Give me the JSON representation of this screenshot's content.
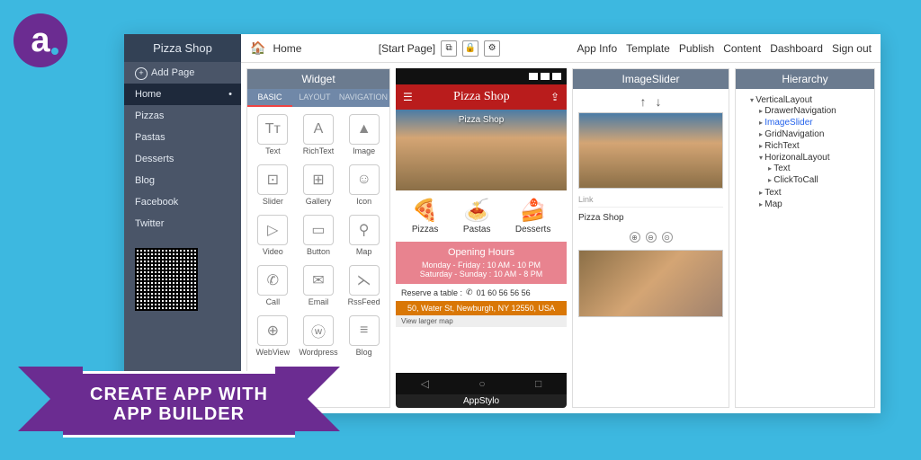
{
  "logo_letter": "a",
  "sidebar": {
    "title": "Pizza Shop",
    "add_page": "Add Page",
    "items": [
      "Home",
      "Pizzas",
      "Pastas",
      "Desserts",
      "Blog",
      "Facebook",
      "Twitter"
    ]
  },
  "toolbar": {
    "home": "Home",
    "start_page": "[Start Page]",
    "links": [
      "App Info",
      "Template",
      "Publish",
      "Content",
      "Dashboard",
      "Sign out"
    ]
  },
  "widget": {
    "title": "Widget",
    "tabs": [
      "BASIC",
      "LAYOUT",
      "NAVIGATION"
    ],
    "items": [
      {
        "label": "Text",
        "glyph": "Tт"
      },
      {
        "label": "RichText",
        "glyph": "A"
      },
      {
        "label": "Image",
        "glyph": "▲"
      },
      {
        "label": "Slider",
        "glyph": "⊡"
      },
      {
        "label": "Gallery",
        "glyph": "⊞"
      },
      {
        "label": "Icon",
        "glyph": "☺"
      },
      {
        "label": "Video",
        "glyph": "▷"
      },
      {
        "label": "Button",
        "glyph": "▭"
      },
      {
        "label": "Map",
        "glyph": "⚲"
      },
      {
        "label": "Call",
        "glyph": "✆"
      },
      {
        "label": "Email",
        "glyph": "✉"
      },
      {
        "label": "RssFeed",
        "glyph": "⋋"
      },
      {
        "label": "WebView",
        "glyph": "⊕"
      },
      {
        "label": "Wordpress",
        "glyph": "ⓦ"
      },
      {
        "label": "Blog",
        "glyph": "≡"
      }
    ]
  },
  "phone": {
    "app_title": "Pizza Shop",
    "hero_label": "Pizza Shop",
    "cats": [
      "Pizzas",
      "Pastas",
      "Desserts"
    ],
    "hours_title": "Opening Hours",
    "hours1": "Monday - Friday : 10 AM - 10 PM",
    "hours2": "Saturday - Sunday : 10 AM - 8 PM",
    "reserve_label": "Reserve a table :",
    "reserve_phone": "01 60 56 56 56",
    "address": "50, Water St, Newburgh, NY 12550, USA",
    "map_hint": "View larger map",
    "caption": "AppStylo"
  },
  "slider": {
    "title": "ImageSlider",
    "link": "Link",
    "shop": "Pizza Shop"
  },
  "hierarchy": {
    "title": "Hierarchy",
    "root": "VerticalLayout",
    "items": [
      "DrawerNavigation",
      "ImageSlider",
      "GridNavigation",
      "RichText",
      "HorizonalLayout"
    ],
    "sub": [
      "Text",
      "ClickToCall"
    ],
    "tail": [
      "Text",
      "Map"
    ]
  },
  "banner": {
    "line1": "CREATE APP WITH",
    "line2": "APP BUILDER"
  }
}
